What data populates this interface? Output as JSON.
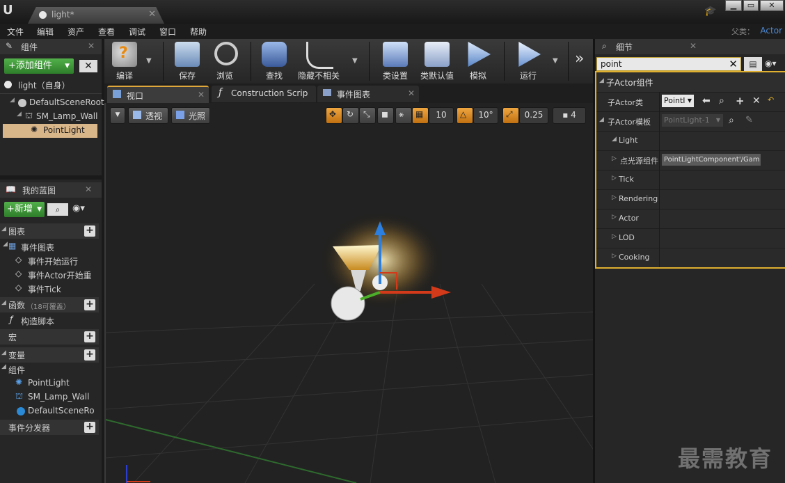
{
  "window": {
    "tab_title": "light*",
    "tab_close": "✕",
    "min": "▁",
    "max": "▭",
    "close": "✕"
  },
  "menu": [
    "文件",
    "编辑",
    "资产",
    "查看",
    "调试",
    "窗口",
    "帮助"
  ],
  "parent_class": {
    "label": "父类：",
    "value": "Actor"
  },
  "components": {
    "tab_title": "组件",
    "add_button": "+添加组件",
    "self_row": "light（自身）",
    "tree": [
      "DefaultSceneRoot",
      "SM_Lamp_Wall",
      "PointLight"
    ]
  },
  "blueprint": {
    "tab_title": "我的蓝图",
    "new_button": "+新增",
    "sections": {
      "graphs": "图表",
      "event_graph": "事件图表",
      "events": [
        "事件开始运行",
        "事件Actor开始重",
        "事件Tick"
      ],
      "functions": "函数",
      "functions_hint": "（18可覆盖）",
      "construction_script": "构造脚本",
      "macros": "宏",
      "variables": "变量",
      "components": "组件",
      "component_items": [
        "PointLight",
        "SM_Lamp_Wall",
        "DefaultSceneRo"
      ],
      "dispatchers": "事件分发器"
    }
  },
  "toolbar": {
    "compile": "编译",
    "save": "保存",
    "browse": "浏览",
    "find": "查找",
    "hide_unrelated": "隐藏不相关",
    "class_settings": "类设置",
    "class_defaults": "类默认值",
    "simulate": "模拟",
    "play": "运行",
    "more": "»"
  },
  "editor_tabs": {
    "viewport": "视口",
    "construction": "Construction Scrip",
    "event_graph": "事件图表"
  },
  "viewport": {
    "perspective": "透视",
    "lit": "光照",
    "grid_snap": "10",
    "rot_snap": "10°",
    "scale_snap": "0.25",
    "camera_speed": "4"
  },
  "details": {
    "tab_title": "细节",
    "search_value": "point",
    "category": "子Actor组件",
    "rows": {
      "child_actor_class": "子Actor类",
      "child_actor_class_value": "PointI",
      "child_actor_template": "子Actor模板",
      "child_actor_template_value": "PointLight-1",
      "light": "Light",
      "point_light_comp": "点光源组件",
      "point_light_comp_value": "PointLightComponent'/Gam",
      "tick": "Tick",
      "rendering": "Rendering",
      "actor": "Actor",
      "lod": "LOD",
      "cooking": "Cooking"
    }
  },
  "watermark": "最需教育",
  "colors": {
    "accent_orange": "#e0b030",
    "selection": "#d9b68a",
    "axis_x": "#d23a1a",
    "axis_y": "#4caf2a",
    "axis_z": "#2a7fe0"
  }
}
